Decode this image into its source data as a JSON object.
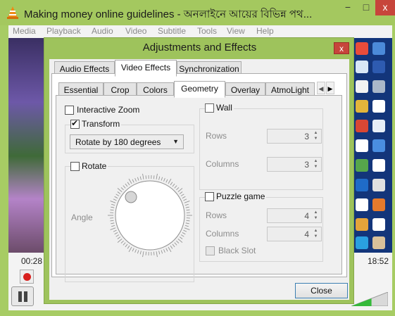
{
  "vlc": {
    "title": "Making money online guidelines - অনলাইনে আয়ের বিভিন্ন পথ...",
    "window_buttons": {
      "minimize": "−",
      "maximize": "□",
      "close": "x"
    },
    "menu": [
      "Media",
      "Playback",
      "Audio",
      "Video",
      "Subtitle",
      "Tools",
      "View",
      "Help"
    ],
    "time_elapsed": "00:28",
    "time_total": "18:52",
    "volume_level": 0.55
  },
  "dialog": {
    "title": "Adjustments and Effects",
    "close_glyph": "x",
    "tabs": [
      "Audio Effects",
      "Video Effects",
      "Synchronization"
    ],
    "active_tab": "Video Effects",
    "subtabs": [
      "Essential",
      "Crop",
      "Colors",
      "Geometry",
      "Overlay",
      "AtmoLight"
    ],
    "active_subtab": "Geometry",
    "scroll_left": "◀",
    "scroll_right": "▶",
    "geometry": {
      "interactive_zoom": {
        "label": "Interactive Zoom",
        "checked": false
      },
      "transform": {
        "label": "Transform",
        "checked": true,
        "selected": "Rotate by 180 degrees"
      },
      "rotate": {
        "label": "Rotate",
        "checked": false,
        "angle_label": "Angle"
      },
      "wall": {
        "label": "Wall",
        "checked": false,
        "rows_label": "Rows",
        "rows": "3",
        "columns_label": "Columns",
        "columns": "3"
      },
      "puzzle": {
        "label": "Puzzle game",
        "checked": false,
        "rows_label": "Rows",
        "rows": "4",
        "columns_label": "Columns",
        "columns": "4",
        "black_slot_label": "Black Slot"
      }
    },
    "close_button": "Close"
  },
  "colors": {
    "title_bar": "#a4c85f",
    "close_red": "#c7453b",
    "record_red": "#d8201e",
    "volume_green": "#35b93a"
  }
}
